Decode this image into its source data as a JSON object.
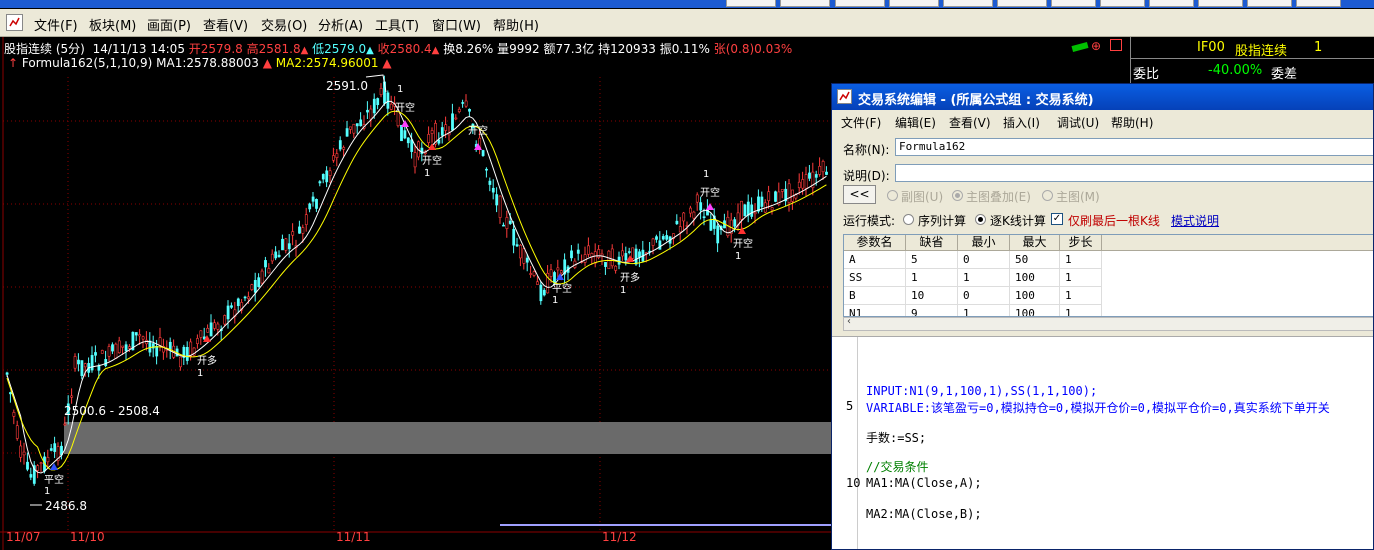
{
  "window": {
    "title_partial": ""
  },
  "menubar": {
    "items": [
      "文件(F)",
      "板块(M)",
      "画面(P)",
      "查看(V)",
      "交易(O)",
      "分析(A)",
      "工具(T)",
      "窗口(W)",
      "帮助(H)"
    ]
  },
  "chart_info": {
    "line1": {
      "symbol": "股指连续 (5分)",
      "datetime": "14/11/13 14:05",
      "open": "开2579.8",
      "high": "高2581.8",
      "low": "低2579.0",
      "close": "收2580.4",
      "turnover": "换8.26%",
      "volume": "量9992",
      "amount": "额77.3亿",
      "hold": "持120933",
      "amplitude": "振0.11%",
      "change": "张(0.8)0.03%"
    },
    "line2": {
      "formula": "Formula162(5,1,10,9)",
      "ma1": "MA1:2578.88003",
      "ma2": "MA2:2574.96001"
    }
  },
  "chart_annotations": {
    "high_price": "2591.0",
    "low_price": "2486.8",
    "zone_label": "2500.6 - 2508.4",
    "signals": [
      {
        "label": "平空",
        "qty": "1"
      },
      {
        "label": "开多",
        "qty": "1"
      },
      {
        "label": "开空",
        "qty": "1"
      },
      {
        "label": "开空",
        "qty": "1"
      },
      {
        "label": "开空",
        "qty": "1"
      },
      {
        "label": "平空",
        "qty": "1"
      },
      {
        "label": "开多",
        "qty": "1"
      },
      {
        "label": "开空",
        "qty": "1"
      },
      {
        "label": "开空",
        "qty": "1"
      }
    ],
    "date_labels": [
      "11/07",
      "11/10",
      "11/11",
      "11/12"
    ]
  },
  "right_panel": {
    "code": "IF00",
    "name": "股指连续",
    "num": "1",
    "weibi_label": "委比",
    "weibi_value": "-40.00%",
    "weicha_label": "委差"
  },
  "dialog": {
    "title": "交易系统编辑 - (所属公式组 : 交易系统)",
    "menu": [
      "文件(F)",
      "编辑(E)",
      "查看(V)",
      "插入(I)",
      "调试(U)",
      "帮助(H)"
    ],
    "name_label": "名称(N):",
    "name_value": "Formula162",
    "desc_label": "说明(D):",
    "desc_value": "",
    "collapse_btn": "<<",
    "chart_modes": [
      "副图(U)",
      "主图叠加(E)",
      "主图(M)"
    ],
    "run_mode_label": "运行模式:",
    "run_modes": [
      "序列计算",
      "逐K线计算"
    ],
    "only_last_label": "仅刷最后一根K线",
    "mode_help_link": "模式说明",
    "param_headers": [
      "参数名",
      "缺省",
      "最小",
      "最大",
      "步长"
    ],
    "params": [
      [
        "A",
        "5",
        "0",
        "50",
        "1"
      ],
      [
        "SS",
        "1",
        "1",
        "100",
        "1"
      ],
      [
        "B",
        "10",
        "0",
        "100",
        "1"
      ],
      [
        "N1",
        "9",
        "1",
        "100",
        "1"
      ]
    ],
    "code_lines": [
      {
        "ln": "",
        "text": "INPUT:N1(9,1,100,1),SS(1,1,100);"
      },
      {
        "ln": "5",
        "text": "VARIABLE:该笔盈亏=0,模拟持仓=0,模拟开仓价=0,模拟平仓价=0,真实系统下单开关"
      },
      {
        "ln": "",
        "text": "手数:=SS;"
      },
      {
        "ln": "",
        "text": "//交易条件"
      },
      {
        "ln": "10",
        "text": "MA1:MA(Close,A);"
      },
      {
        "ln": "",
        "text": "MA2:MA(Close,B);"
      }
    ]
  },
  "colors": {
    "up": "#ff3b3b",
    "down": "#54ffff",
    "ma1": "#ffffff",
    "ma2": "#ffff00",
    "grid": "#8b0000",
    "keyword_blue": "#0000ff",
    "comment_green": "#008000"
  }
}
